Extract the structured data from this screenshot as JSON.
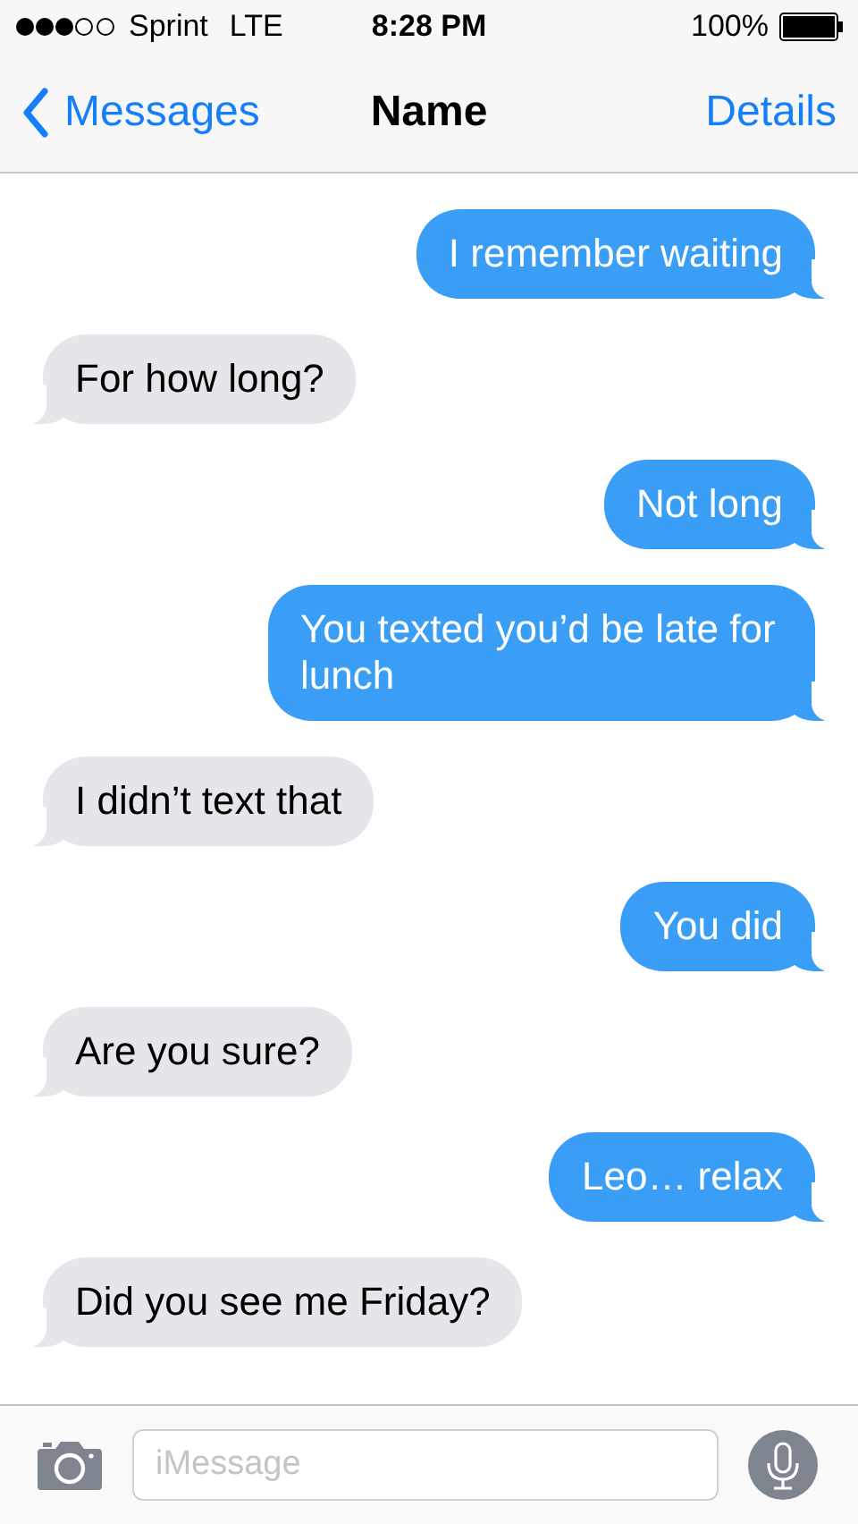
{
  "status_bar": {
    "carrier": "Sprint",
    "network": "LTE",
    "time": "8:28 PM",
    "battery": "100%"
  },
  "nav": {
    "back": "Messages",
    "title": "Name",
    "action": "Details"
  },
  "messages": [
    {
      "kind": "sent",
      "text": "I remember waiting"
    },
    {
      "kind": "received",
      "text": "For how long?"
    },
    {
      "kind": "sent",
      "text": "Not long"
    },
    {
      "kind": "sent",
      "text": "You texted you’d be late for lunch"
    },
    {
      "kind": "received",
      "text": "I didn’t text that"
    },
    {
      "kind": "sent",
      "text": "You did"
    },
    {
      "kind": "received",
      "text": "Are you sure?"
    },
    {
      "kind": "sent",
      "text": "Leo… relax"
    },
    {
      "kind": "received",
      "text": "Did you see me Friday?"
    }
  ],
  "composer": {
    "placeholder": "iMessage"
  }
}
